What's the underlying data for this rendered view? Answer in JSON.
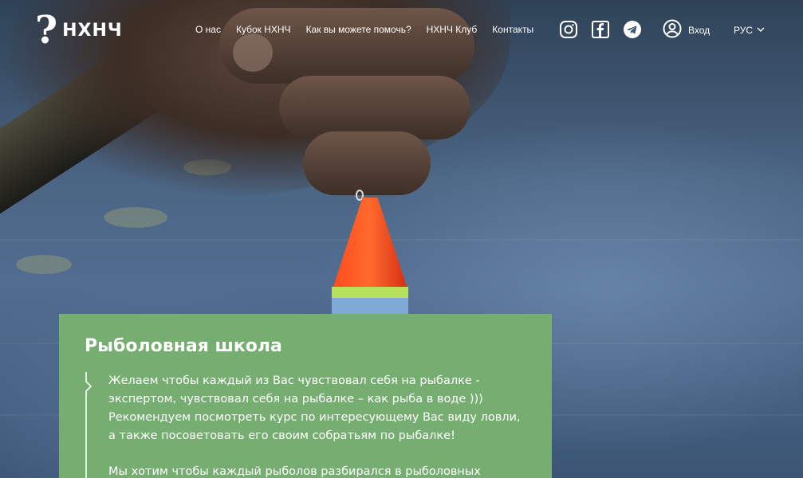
{
  "header": {
    "logo_mark": "?",
    "logo_text": "НХНЧ",
    "nav": [
      {
        "label": "О нас"
      },
      {
        "label": "Кубок НХНЧ"
      },
      {
        "label": "Как вы можете помочь?"
      },
      {
        "label": "НХНЧ Клуб"
      },
      {
        "label": "Контакты"
      }
    ],
    "social": [
      {
        "icon": "instagram-icon"
      },
      {
        "icon": "facebook-icon"
      },
      {
        "icon": "telegram-icon"
      }
    ],
    "login_label": "Вход",
    "language": "РУС"
  },
  "card": {
    "title": "Рыболовная школа",
    "paragraph1": "Желаем чтобы каждый из Вас чувствовал себя на рыбалке - экспертом, чувствовал себя на рыбалке – как рыба в воде ))) Рекомендуем посмотреть курс по интересующему Вас виду ловли, а также посоветовать его своим собратьям по рыбалке!",
    "paragraph2": "Мы хотим чтобы каждый рыболов разбирался в рыболовных",
    "background_color": "#76ad70"
  }
}
